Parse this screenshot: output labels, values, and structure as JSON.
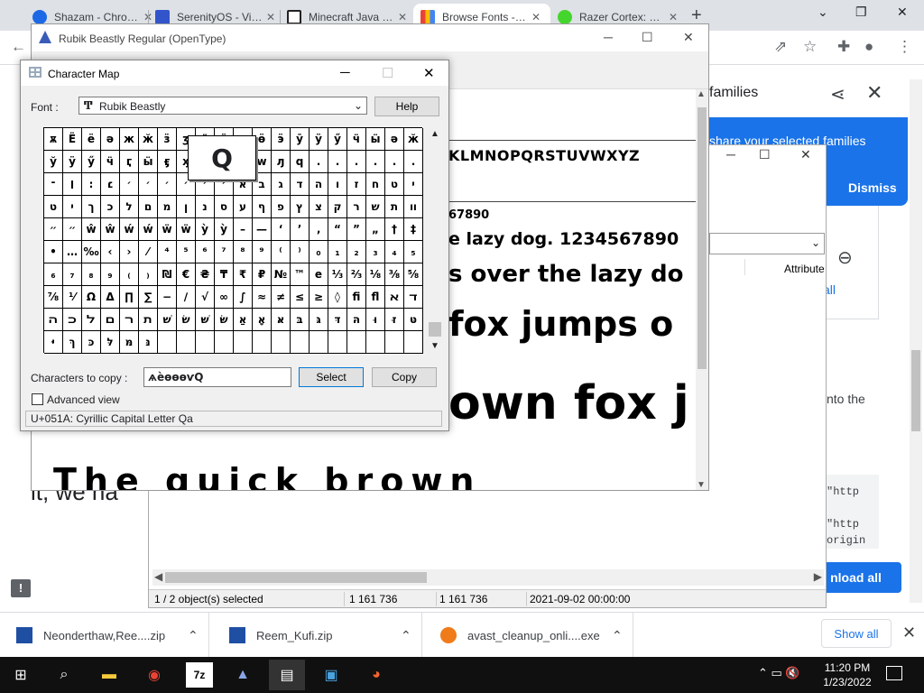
{
  "browser": {
    "tabs": [
      {
        "title": "Shazam - Chrome",
        "color": "#1d68e5",
        "active": false
      },
      {
        "title": "SerenityOS - Virtual",
        "color": "#3355cc",
        "active": false
      },
      {
        "title": "Minecraft Java Edition",
        "color": "#222222",
        "active": false
      },
      {
        "title": "Browse Fonts - Google",
        "color": "#ea4335",
        "active": true
      },
      {
        "title": "Razer Cortex: Game",
        "color": "#44d62c",
        "active": false
      }
    ],
    "new_tab_label": "+",
    "window_controls": {
      "minimize": "⌄",
      "restore": "❐",
      "close": "✕"
    }
  },
  "background_page": {
    "families_text": "families",
    "banner_message": "share your selected families",
    "dismiss_label": "Dismiss",
    "all_link": "all",
    "into_the_text": "nto the",
    "partial_text": "it, we ha",
    "code_lines": [
      "\"http",
      "\"http",
      "origin"
    ],
    "download_all_label": "nload all",
    "chat_icon_glyph": "!"
  },
  "zip_window": {
    "attribute_header": "Attribute",
    "status": {
      "selected": "1 / 2 object(s) selected",
      "size1": "1 161 736",
      "size2": "1 161 736",
      "date": "2021-09-02 00:00:00"
    }
  },
  "font_viewer": {
    "title": "Rubik Beastly Regular (OpenType)",
    "alphabet_upper": "KLMNOPQRSTUVWXYZ",
    "digits": "67890",
    "sample_12": "e lazy dog. 1234567890",
    "sample_18": "s over the lazy do",
    "sample_24": "fox jumps o",
    "sample_36": "own fox j",
    "sample_48": "The quick brown"
  },
  "charmap": {
    "title": "Character Map",
    "font_label": "Font :",
    "font_value": "Rubik Beastly",
    "help_label": "Help",
    "zoom_char": "Q",
    "grid_chars": [
      "ѫ",
      "Ё",
      "ё",
      "ә",
      "ж",
      "ӂ",
      "ӟ",
      "ӡ",
      "ӥ",
      "ӧ",
      "ө",
      "ӫ",
      "ӭ",
      "ӯ",
      "ӱ",
      "ӳ",
      "ӵ",
      "ӹ",
      "ә",
      "ӂ",
      "ў",
      "ӱ",
      "ӳ",
      "ӵ",
      "ӷ",
      "ӹ",
      "ӻ",
      "ӽ",
      "ӿ",
      "ԁ",
      "ԃ",
      "w",
      "ԓ",
      "ԛ",
      ".",
      ".",
      ".",
      ".",
      ".",
      ".",
      "־",
      "׀",
      "׃",
      "׆",
      "׳",
      "׳",
      "׳",
      "׳",
      "׳",
      "׳",
      "א",
      "ב",
      "ג",
      "ד",
      "ה",
      "ו",
      "ז",
      "ח",
      "ט",
      "י",
      "ט",
      "י",
      "ך",
      "כ",
      "ל",
      "ם",
      "מ",
      "ן",
      "נ",
      "ס",
      "ע",
      "ף",
      "פ",
      "ץ",
      "צ",
      "ק",
      "ר",
      "ש",
      "ת",
      "װ",
      "״",
      "״",
      "ŵ",
      "ŵ",
      "ẃ",
      "ẃ",
      "ẅ",
      "ẅ",
      "ỳ",
      "ỳ",
      "–",
      "—",
      "‘",
      "’",
      "‚",
      "“",
      "”",
      "„",
      "†",
      "‡",
      "•",
      "…",
      "‰",
      "‹",
      "›",
      "⁄",
      "⁴",
      "⁵",
      "⁶",
      "⁷",
      "⁸",
      "⁹",
      "⁽",
      "⁾",
      "₀",
      "₁",
      "₂",
      "₃",
      "₄",
      "₅",
      "₆",
      "₇",
      "₈",
      "₉",
      "₍",
      "₎",
      "₪",
      "€",
      "₴",
      "₸",
      "₹",
      "₽",
      "№",
      "™",
      "e",
      "⅓",
      "⅔",
      "⅛",
      "⅜",
      "⅝",
      "⅞",
      "⅟",
      "Ω",
      "Δ",
      "∏",
      "∑",
      "−",
      "∕",
      "√",
      "∞",
      "∫",
      "≈",
      "≠",
      "≤",
      "≥",
      "◊",
      "ﬁ",
      "ﬂ",
      "ﬡ",
      "ﬢ",
      "ﬣ",
      "ﬤ",
      "ﬥ",
      "ﬦ",
      "ﬧ",
      "ﬨ",
      "שׁ",
      "שׂ",
      "שּׁ",
      "שּׂ",
      "אַ",
      "אָ",
      "אּ",
      "בּ",
      "גּ",
      "דּ",
      "הּ",
      "וּ",
      "זּ",
      "טּ",
      "יּ",
      "ךּ",
      "כּ",
      "לּ",
      "מּ",
      "נּ",
      "",
      "",
      "",
      "",
      "",
      "",
      "",
      "",
      "",
      "",
      "",
      "",
      "",
      ""
    ],
    "copy_label": "Characters to copy :",
    "copy_value": "ѧѐѳѳѳѵԚ",
    "select_label": "Select",
    "copy_button_label": "Copy",
    "advanced_label": "Advanced view",
    "status_text": "U+051A: Cyrillic Capital Letter Qa"
  },
  "downloads": {
    "items": [
      {
        "name": "Neonderthaw,Ree....zip",
        "icon_color": "#1f4fa3"
      },
      {
        "name": "Reem_Kufi.zip",
        "icon_color": "#1f4fa3"
      },
      {
        "name": "avast_cleanup_onli....exe",
        "icon_color": "#f07b1a"
      }
    ],
    "show_all_label": "Show all"
  },
  "taskbar": {
    "time": "11:20 PM",
    "date": "1/23/2022"
  }
}
